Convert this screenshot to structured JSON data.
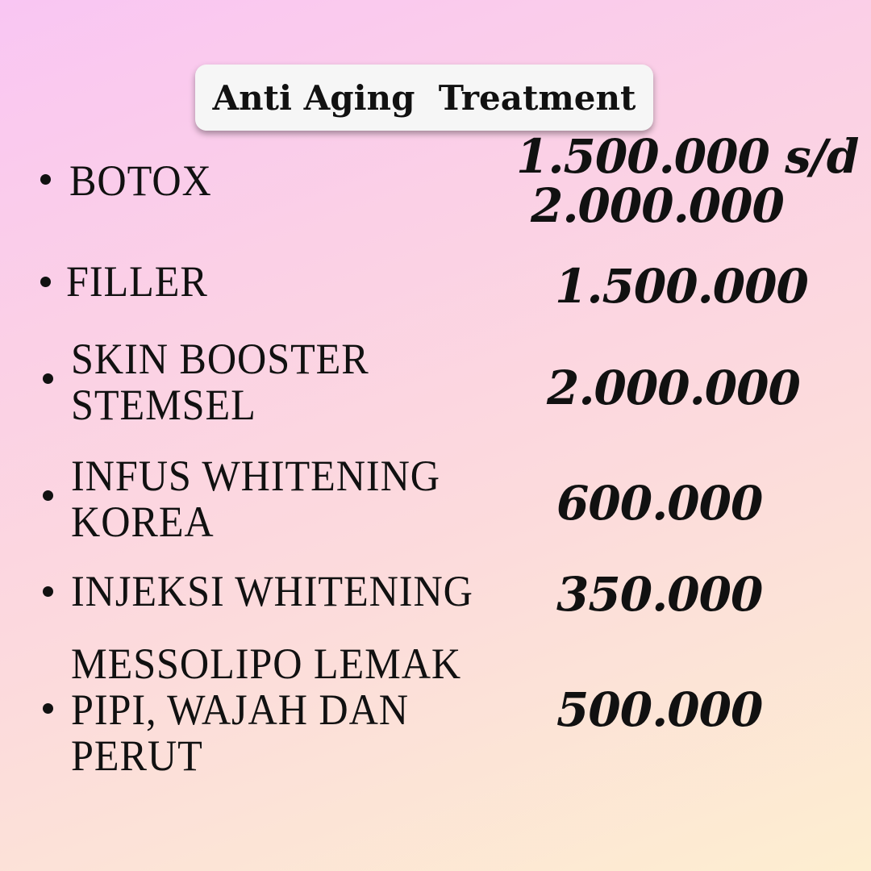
{
  "title": "Anti Aging  Treatment",
  "treatments": [
    {
      "name_lines": [
        "BOTOX"
      ],
      "price_lines": [
        "1.500.000 s/d",
        "2.000.000"
      ]
    },
    {
      "name_lines": [
        "FILLER"
      ],
      "price_lines": [
        "1.500.000"
      ]
    },
    {
      "name_lines": [
        "SKIN BOOSTER",
        "STEMSEL"
      ],
      "price_lines": [
        "2.000.000"
      ]
    },
    {
      "name_lines": [
        "INFUS WHITENING",
        "KOREA"
      ],
      "price_lines": [
        "600.000"
      ]
    },
    {
      "name_lines": [
        "INJEKSI WHITENING"
      ],
      "price_lines": [
        "350.000"
      ]
    },
    {
      "name_lines": [
        "MESSOLIPO LEMAK",
        "PIPI, WAJAH DAN",
        "PERUT"
      ],
      "price_lines": [
        "500.000"
      ]
    }
  ],
  "colors": {
    "text": "#111111",
    "title_box": "#f6f6f6",
    "bg_top": "#f9c6f3",
    "bg_bottom": "#fdeed0"
  }
}
